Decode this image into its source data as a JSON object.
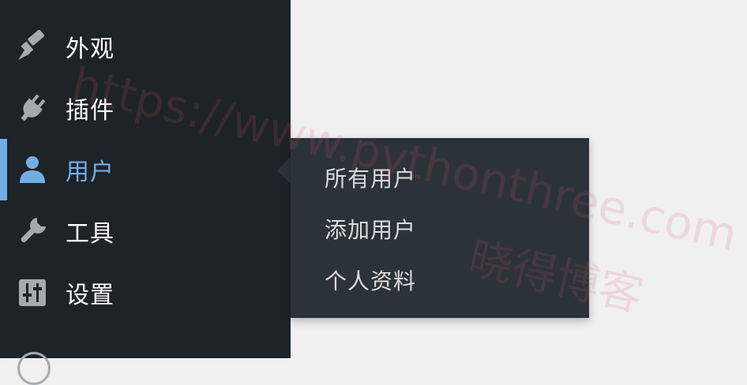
{
  "sidebar": {
    "items": [
      {
        "label": "外观",
        "icon": "brush-icon"
      },
      {
        "label": "插件",
        "icon": "plugin-icon"
      },
      {
        "label": "用户",
        "icon": "user-icon",
        "active": true
      },
      {
        "label": "工具",
        "icon": "wrench-icon"
      },
      {
        "label": "设置",
        "icon": "settings-sliders-icon"
      }
    ]
  },
  "flyout": {
    "items": [
      "所有用户",
      "添加用户",
      "个人资料"
    ]
  },
  "watermark": {
    "url": "https://www.pythonthree.com",
    "name": "晓得博客"
  },
  "colors": {
    "sidebar_bg": "#1d2327",
    "flyout_bg": "#2c3338",
    "accent": "#72aee6",
    "page_bg": "#f0f0f1"
  }
}
